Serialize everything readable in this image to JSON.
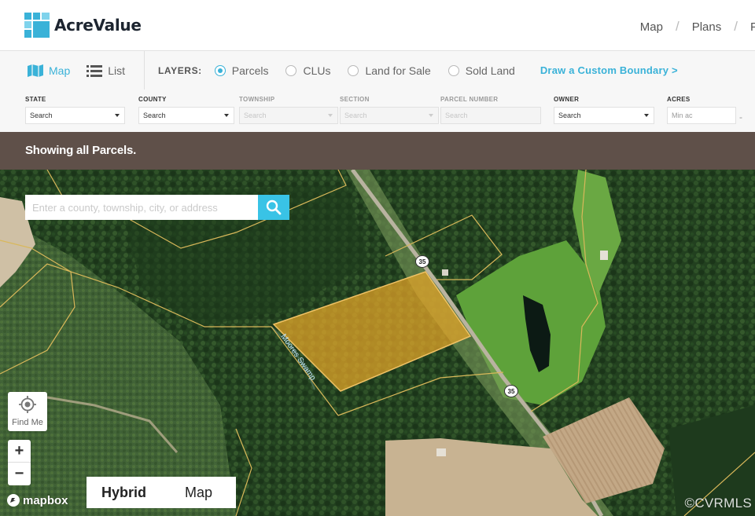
{
  "brand": {
    "name": "AcreValue"
  },
  "header": {
    "nav": [
      "Map",
      "Plans",
      "P"
    ]
  },
  "toolbar": {
    "view_toggle": {
      "map": "Map",
      "list": "List"
    },
    "layers_label": "LAYERS:",
    "layers": [
      {
        "label": "Parcels",
        "selected": true
      },
      {
        "label": "CLUs",
        "selected": false
      },
      {
        "label": "Land for Sale",
        "selected": false
      },
      {
        "label": "Sold Land",
        "selected": false
      }
    ],
    "draw_link": "Draw a Custom Boundary >"
  },
  "filters": {
    "state": {
      "label": "STATE",
      "value": "Search"
    },
    "county": {
      "label": "COUNTY",
      "value": "Search"
    },
    "township": {
      "label": "TOWNSHIP",
      "value": "Search"
    },
    "section": {
      "label": "SECTION",
      "value": "Search"
    },
    "parcel_number": {
      "label": "PARCEL NUMBER",
      "value": "Search"
    },
    "owner": {
      "label": "OWNER",
      "value": "Search"
    },
    "acres": {
      "label": "ACRES",
      "min_placeholder": "Min ac",
      "range_sep": "-"
    }
  },
  "status": {
    "text": "Showing all Parcels."
  },
  "map": {
    "search_placeholder": "Enter a county, township, city, or address",
    "find_me": "Find Me",
    "zoom_in": "+",
    "zoom_out": "−",
    "basemap_options": [
      {
        "label": "Hybrid",
        "selected": true
      },
      {
        "label": "Map",
        "selected": false
      }
    ],
    "attribution": "mapbox",
    "watermark": "©CVRMLS",
    "route_shields": [
      "35",
      "35"
    ],
    "stream_label": "Moores Swamp"
  },
  "colors": {
    "accent": "#3ab2d8",
    "search_button": "#39c3e6",
    "selected_parcel": "#e8a628",
    "parcel_lines": "#d9b85a",
    "status_bar": "#5f5049"
  }
}
